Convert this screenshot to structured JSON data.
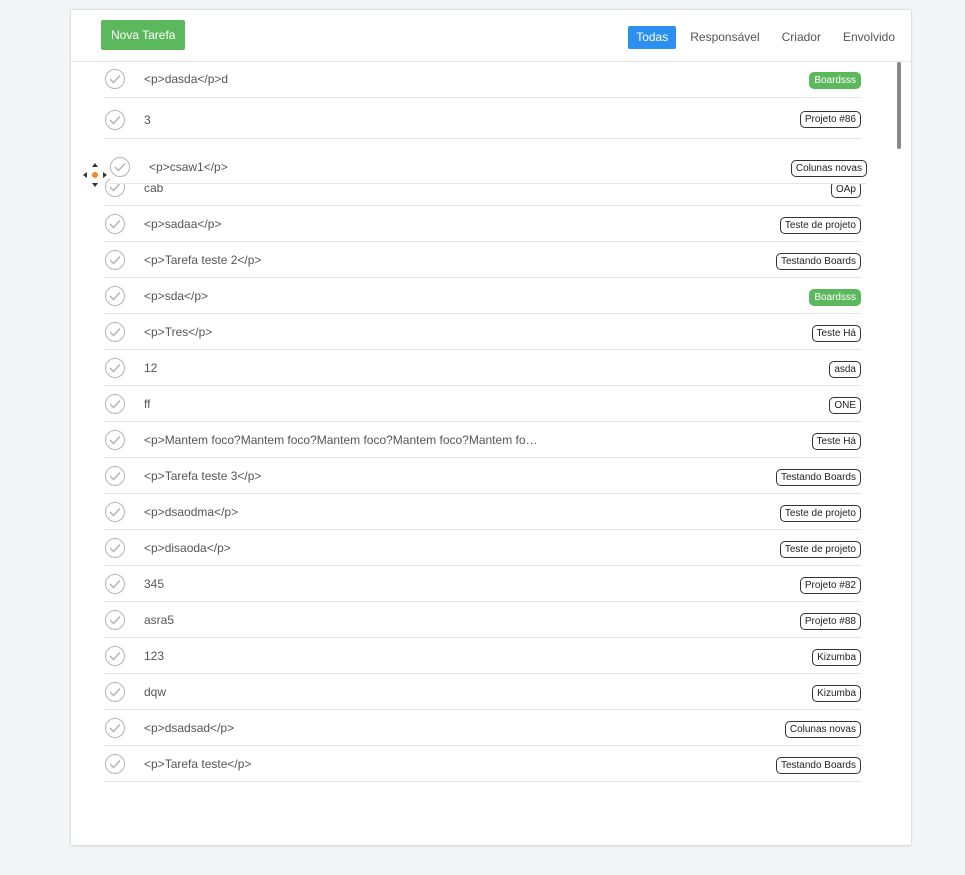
{
  "toolbar": {
    "new_task_label": "Nova Tarefa"
  },
  "filters": [
    {
      "label": "Todas",
      "active": true
    },
    {
      "label": "Responsável",
      "active": false
    },
    {
      "label": "Criador",
      "active": false
    },
    {
      "label": "Envolvido",
      "active": false
    }
  ],
  "tasks": [
    {
      "title": "<p>dasda</p>d",
      "tag": "Boardsss",
      "tag_style": "green"
    },
    {
      "title": "3",
      "tag": "Projeto #86",
      "tag_style": "outline"
    },
    {
      "title": "cab",
      "tag": "OAp",
      "tag_style": "outline"
    },
    {
      "title": "<p>sadaa</p>",
      "tag": "Teste de projeto",
      "tag_style": "outline"
    },
    {
      "title": "<p>Tarefa teste 2</p>",
      "tag": "Testando Boards",
      "tag_style": "outline"
    },
    {
      "title": "<p>sda</p>",
      "tag": "Boardsss",
      "tag_style": "green"
    },
    {
      "title": "<p>Tres</p>",
      "tag": "Teste Há",
      "tag_style": "outline"
    },
    {
      "title": "12",
      "tag": "asda",
      "tag_style": "outline"
    },
    {
      "title": "ff",
      "tag": "ONE",
      "tag_style": "outline"
    },
    {
      "title": "<p>Mantem foco?Mantem foco?Mantem foco?Mantem foco?Mantem fo…",
      "tag": "Teste Há",
      "tag_style": "outline"
    },
    {
      "title": "<p>Tarefa teste 3</p>",
      "tag": "Testando Boards",
      "tag_style": "outline"
    },
    {
      "title": "<p>dsaodma</p>",
      "tag": "Teste de projeto",
      "tag_style": "outline"
    },
    {
      "title": "<p>disaoda</p>",
      "tag": "Teste de projeto",
      "tag_style": "outline"
    },
    {
      "title": "345",
      "tag": "Projeto #82",
      "tag_style": "outline"
    },
    {
      "title": "asra5",
      "tag": "Projeto #88",
      "tag_style": "outline"
    },
    {
      "title": "123",
      "tag": "Kizumba",
      "tag_style": "outline"
    },
    {
      "title": "dqw",
      "tag": "Kizumba",
      "tag_style": "outline"
    },
    {
      "title": "<p>dsadsad</p>",
      "tag": "Colunas novas",
      "tag_style": "outline"
    },
    {
      "title": "<p>Tarefa teste</p>",
      "tag": "Testando Boards",
      "tag_style": "outline"
    }
  ],
  "dragging_task": {
    "title": "<p>csaw1</p>",
    "tag": "Colunas novas",
    "tag_style": "outline"
  },
  "icons": {
    "check": "check-circle-icon",
    "drag": "move-cursor-icon"
  },
  "colors": {
    "primary": "#2b90f0",
    "success": "#5cb85c"
  }
}
